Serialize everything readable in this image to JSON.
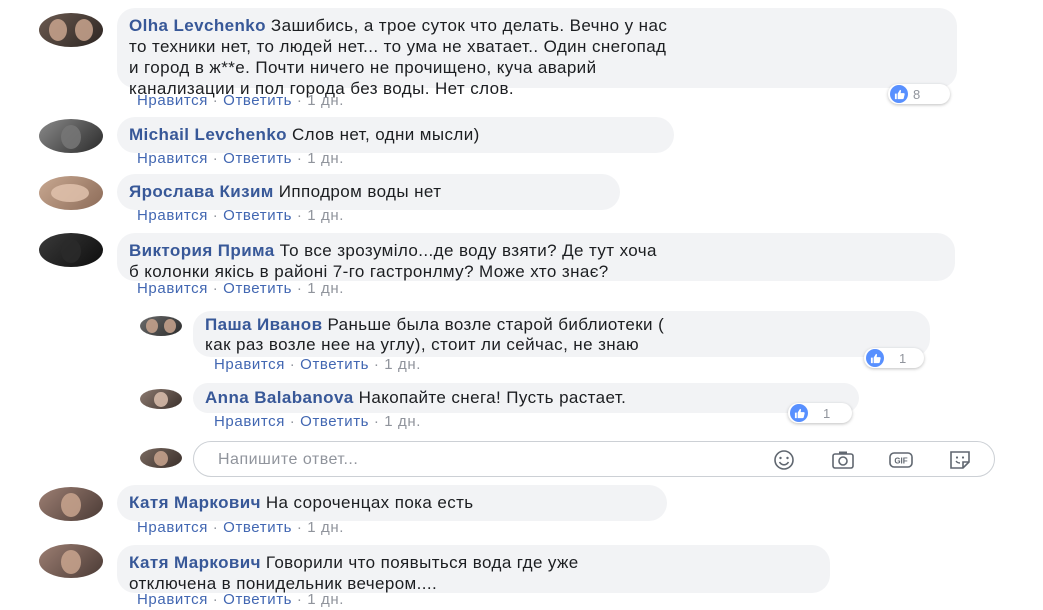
{
  "like_label": "Нравится",
  "reply_label": "Ответить",
  "separator": "·",
  "comments": [
    {
      "author": "Olha Levchenko",
      "text_lines": [
        "Зашибись, а трое суток что делать. Вечно у нас",
        "то техники нет, то людей нет... то ума не хватает.. Один снегопад",
        "и город в ж**е. Почти ничего не прочищено, куча аварий",
        "канализации и пол города без воды. Нет слов."
      ],
      "time": "1 дн.",
      "reactions": "8"
    },
    {
      "author": "Michail Levchenko",
      "text_lines": [
        "Слов нет, одни мысли)"
      ],
      "time": "1 дн."
    },
    {
      "author": "Ярослава Кизим",
      "text_lines": [
        "Ипподром воды нет"
      ],
      "time": "1 дн."
    },
    {
      "author": "Виктория Прима",
      "text_lines": [
        "То все зрозуміло...де воду взяти? Де тут хоча",
        "б колонки якісь в районі 7-го гастронлму? Може хто знає?"
      ],
      "time": "1 дн.",
      "replies": [
        {
          "author": "Паша Иванов",
          "text_lines": [
            "Раньше была возле старой библиотеки (",
            "как раз возле нее на углу), стоит ли сейчас, не знаю"
          ],
          "time": "1 дн.",
          "reactions": "1"
        },
        {
          "author": "Anna Balabanova",
          "text_lines": [
            "Накопайте снега! Пусть растает."
          ],
          "time": "1 дн.",
          "reactions": "1"
        }
      ]
    },
    {
      "author": "Катя Маркович",
      "text_lines": [
        "На сороченцах пока есть"
      ],
      "time": "1 дн."
    },
    {
      "author": "Катя Маркович",
      "text_lines": [
        "Говорили что появыться вода где уже",
        "отключена в понидельник вечером...."
      ],
      "time": "1 дн."
    }
  ],
  "reply_box": {
    "placeholder": "Напишите ответ...",
    "icons": [
      "emoji-icon",
      "camera-icon",
      "gif-icon",
      "sticker-icon"
    ]
  },
  "colors": {
    "link": "#4267b2",
    "author": "#385898",
    "bubble": "#f2f3f5",
    "like": "#5890ff"
  }
}
